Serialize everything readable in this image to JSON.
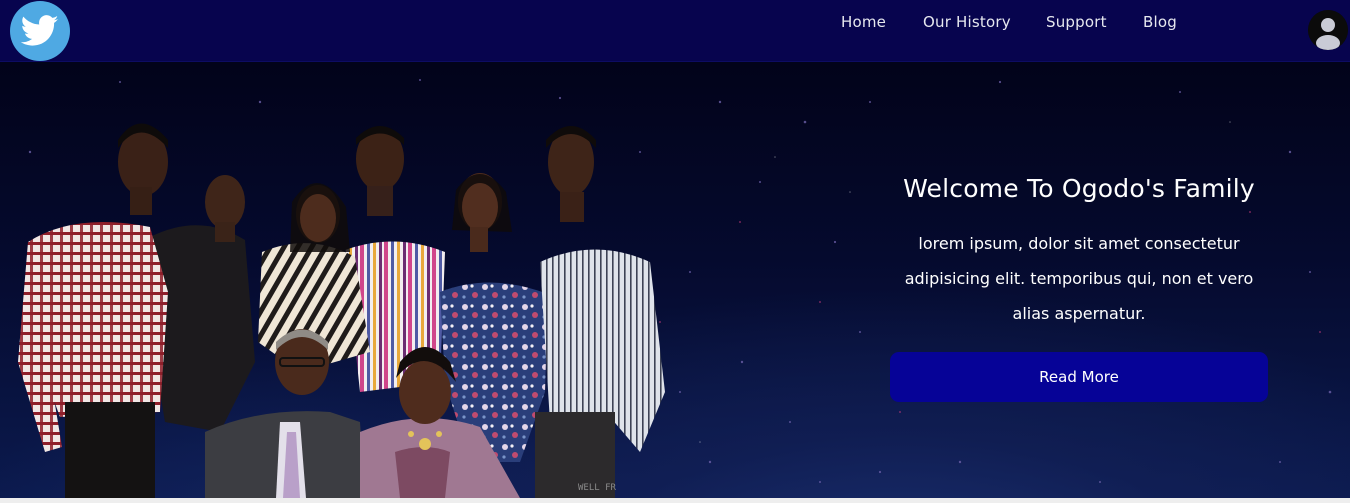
{
  "navbar": {
    "logo_icon": "twitter-bird-icon",
    "links": [
      {
        "label": "Home"
      },
      {
        "label": "Our History"
      },
      {
        "label": "Support"
      },
      {
        "label": "Blog"
      }
    ],
    "avatar_icon": "user-avatar-icon"
  },
  "hero": {
    "title": "Welcome To Ogodo's Family",
    "description": "lorem ipsum, dolor sit amet consectetur adipisicing elit. temporibus qui, non et vero alias aspernatur.",
    "button_label": "Read More",
    "image_watermark": "WELL FR",
    "image_subject": "family-group-photo"
  },
  "colors": {
    "navbar_bg": "#07044e",
    "button_bg": "#060397",
    "logo_bg": "#4fa9e3",
    "hero_bg": "#050a2e"
  }
}
